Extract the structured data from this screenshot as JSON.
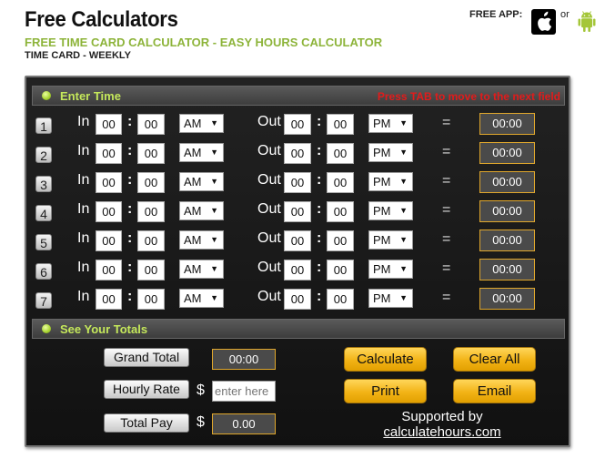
{
  "header": {
    "site_title": "Free Calculators",
    "subtitle": "FREE TIME CARD CALCULATOR - EASY HOURS CALCULATOR",
    "breadcrumb": "TIME CARD - WEEKLY",
    "free_app_label": "FREE APP:",
    "or_label": "or",
    "apps": [
      "apple-app-store",
      "android-google-play"
    ]
  },
  "enter_time": {
    "label": "Enter Time",
    "hint": "Press TAB to move to the next field",
    "in_label": "In",
    "out_label": "Out",
    "equals": "=",
    "rows": [
      {
        "day": "1",
        "in_h": "00",
        "in_m": "00",
        "in_ampm": "AM",
        "out_h": "00",
        "out_m": "00",
        "out_ampm": "PM",
        "total": "00:00"
      },
      {
        "day": "2",
        "in_h": "00",
        "in_m": "00",
        "in_ampm": "AM",
        "out_h": "00",
        "out_m": "00",
        "out_ampm": "PM",
        "total": "00:00"
      },
      {
        "day": "3",
        "in_h": "00",
        "in_m": "00",
        "in_ampm": "AM",
        "out_h": "00",
        "out_m": "00",
        "out_ampm": "PM",
        "total": "00:00"
      },
      {
        "day": "4",
        "in_h": "00",
        "in_m": "00",
        "in_ampm": "AM",
        "out_h": "00",
        "out_m": "00",
        "out_ampm": "PM",
        "total": "00:00"
      },
      {
        "day": "5",
        "in_h": "00",
        "in_m": "00",
        "in_ampm": "AM",
        "out_h": "00",
        "out_m": "00",
        "out_ampm": "PM",
        "total": "00:00"
      },
      {
        "day": "6",
        "in_h": "00",
        "in_m": "00",
        "in_ampm": "AM",
        "out_h": "00",
        "out_m": "00",
        "out_ampm": "PM",
        "total": "00:00"
      },
      {
        "day": "7",
        "in_h": "00",
        "in_m": "00",
        "in_ampm": "AM",
        "out_h": "00",
        "out_m": "00",
        "out_ampm": "PM",
        "total": "00:00"
      }
    ]
  },
  "totals": {
    "label": "See Your Totals",
    "grand_total_label": "Grand Total",
    "grand_total_value": "00:00",
    "hourly_rate_label": "Hourly Rate",
    "currency": "$",
    "hourly_rate_placeholder": "enter here",
    "total_pay_label": "Total Pay",
    "total_pay_value": "0.00"
  },
  "actions": {
    "calculate": "Calculate",
    "clear_all": "Clear All",
    "print": "Print",
    "email": "Email"
  },
  "footer": {
    "supported_by": "Supported by",
    "link": "calculatehours.com"
  }
}
